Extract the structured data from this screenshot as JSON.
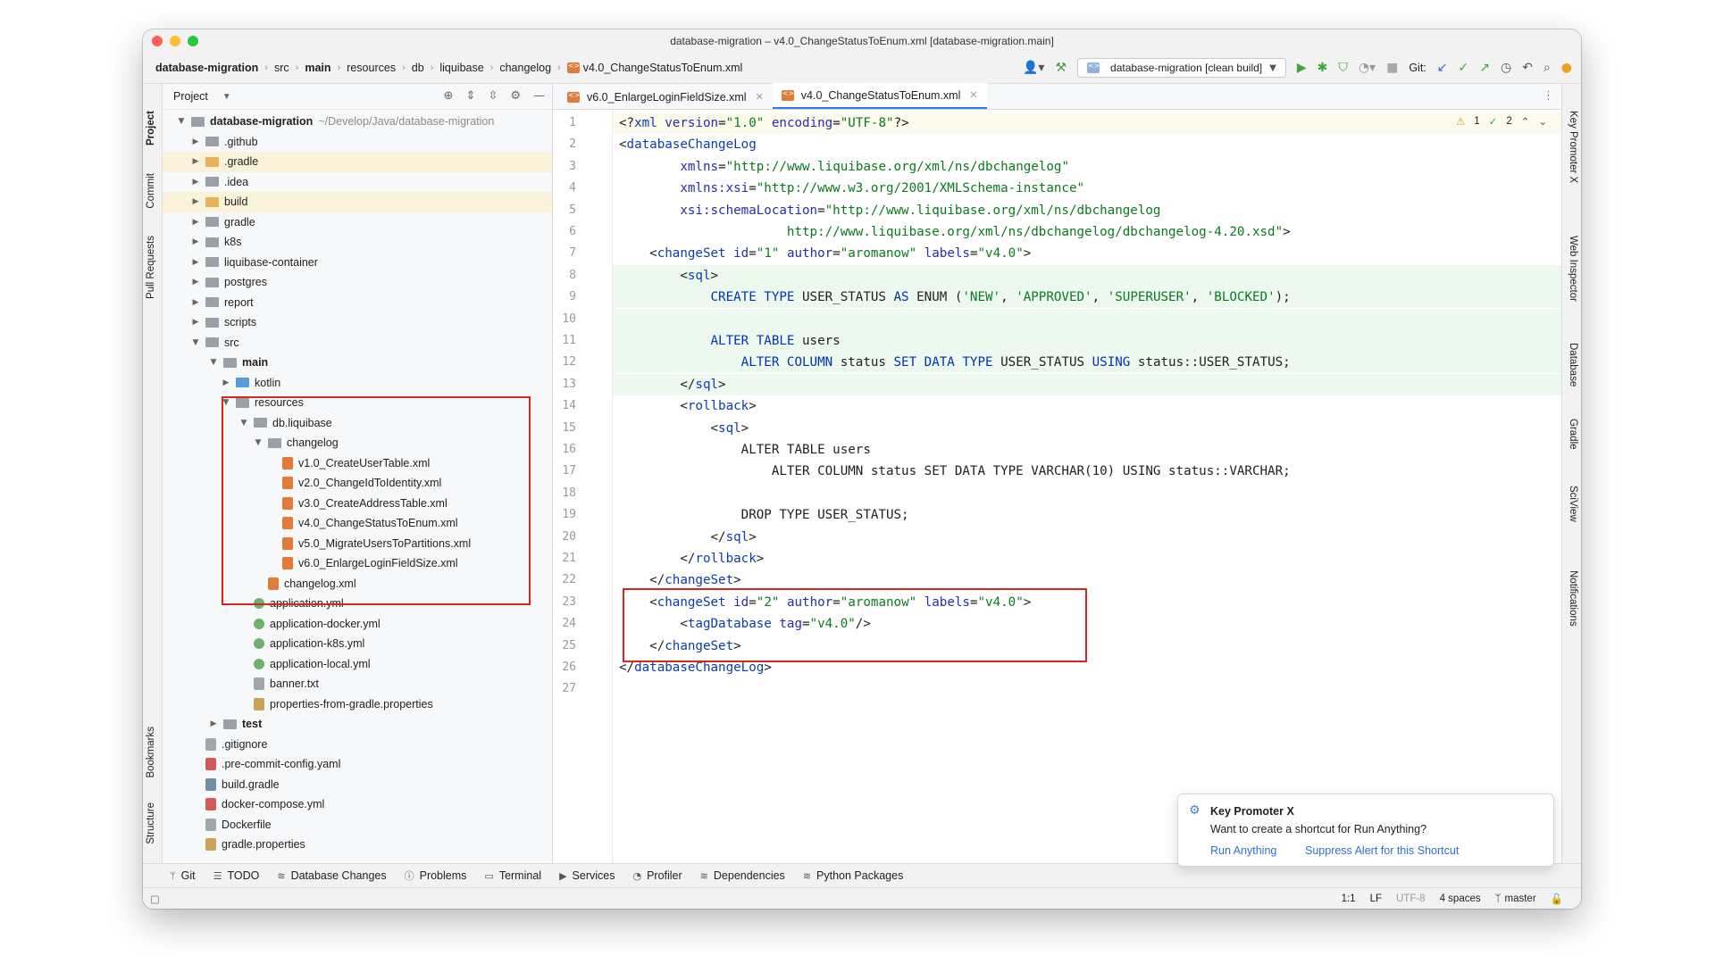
{
  "window": {
    "title": "database-migration – v4.0_ChangeStatusToEnum.xml [database-migration.main]"
  },
  "breadcrumbs": [
    "database-migration",
    "src",
    "main",
    "resources",
    "db",
    "liquibase",
    "changelog",
    "v4.0_ChangeStatusToEnum.xml"
  ],
  "toolbar": {
    "run_config": "database-migration [clean build]",
    "git_label": "Git:"
  },
  "left_stripe": [
    "Project",
    "Commit",
    "Pull Requests",
    "Bookmarks",
    "Structure"
  ],
  "right_stripe": [
    "Key Promoter X",
    "Web Inspector",
    "Database",
    "Gradle",
    "SciView",
    "Notifications"
  ],
  "project_panel": {
    "title": "Project",
    "tree": [
      {
        "label": "database-migration",
        "hint": "~/Develop/Java/database-migration",
        "type": "folder",
        "depth": 0,
        "expanded": true,
        "bold": true
      },
      {
        "label": ".github",
        "type": "folder",
        "depth": 1
      },
      {
        "label": ".gradle",
        "type": "folder-orange",
        "depth": 1,
        "hl": true
      },
      {
        "label": ".idea",
        "type": "folder",
        "depth": 1
      },
      {
        "label": "build",
        "type": "folder-orange",
        "depth": 1,
        "hl": true
      },
      {
        "label": "gradle",
        "type": "folder",
        "depth": 1
      },
      {
        "label": "k8s",
        "type": "folder",
        "depth": 1
      },
      {
        "label": "liquibase-container",
        "type": "folder",
        "depth": 1
      },
      {
        "label": "postgres",
        "type": "folder",
        "depth": 1
      },
      {
        "label": "report",
        "type": "folder",
        "depth": 1
      },
      {
        "label": "scripts",
        "type": "folder",
        "depth": 1
      },
      {
        "label": "src",
        "type": "folder",
        "depth": 1,
        "expanded": true
      },
      {
        "label": "main",
        "type": "folder",
        "depth": 2,
        "expanded": true,
        "bold": true
      },
      {
        "label": "kotlin",
        "type": "folder-blue",
        "depth": 3
      },
      {
        "label": "resources",
        "type": "folder",
        "depth": 3,
        "expanded": true
      },
      {
        "label": "db.liquibase",
        "type": "folder",
        "depth": 4,
        "expanded": true
      },
      {
        "label": "changelog",
        "type": "folder",
        "depth": 5,
        "expanded": true
      },
      {
        "label": "v1.0_CreateUserTable.xml",
        "type": "xml",
        "depth": 6,
        "leaf": true
      },
      {
        "label": "v2.0_ChangeIdToIdentity.xml",
        "type": "xml",
        "depth": 6,
        "leaf": true
      },
      {
        "label": "v3.0_CreateAddressTable.xml",
        "type": "xml",
        "depth": 6,
        "leaf": true
      },
      {
        "label": "v4.0_ChangeStatusToEnum.xml",
        "type": "xml",
        "depth": 6,
        "leaf": true
      },
      {
        "label": "v5.0_MigrateUsersToPartitions.xml",
        "type": "xml",
        "depth": 6,
        "leaf": true
      },
      {
        "label": "v6.0_EnlargeLoginFieldSize.xml",
        "type": "xml",
        "depth": 6,
        "leaf": true
      },
      {
        "label": "changelog.xml",
        "type": "xml",
        "depth": 5,
        "leaf": true
      },
      {
        "label": "application.yml",
        "type": "yml",
        "depth": 4,
        "leaf": true
      },
      {
        "label": "application-docker.yml",
        "type": "yml",
        "depth": 4,
        "leaf": true
      },
      {
        "label": "application-k8s.yml",
        "type": "yml",
        "depth": 4,
        "leaf": true
      },
      {
        "label": "application-local.yml",
        "type": "yml",
        "depth": 4,
        "leaf": true
      },
      {
        "label": "banner.txt",
        "type": "txt",
        "depth": 4,
        "leaf": true
      },
      {
        "label": "properties-from-gradle.properties",
        "type": "prop",
        "depth": 4,
        "leaf": true
      },
      {
        "label": "test",
        "type": "folder",
        "depth": 2,
        "bold": true
      },
      {
        "label": ".gitignore",
        "type": "txt",
        "depth": 1,
        "leaf": true
      },
      {
        "label": ".pre-commit-config.yaml",
        "type": "yaml",
        "depth": 1,
        "leaf": true
      },
      {
        "label": "build.gradle",
        "type": "gradle",
        "depth": 1,
        "leaf": true
      },
      {
        "label": "docker-compose.yml",
        "type": "yaml",
        "depth": 1,
        "leaf": true
      },
      {
        "label": "Dockerfile",
        "type": "txt",
        "depth": 1,
        "leaf": true
      },
      {
        "label": "gradle.properties",
        "type": "prop",
        "depth": 1,
        "leaf": true
      }
    ]
  },
  "editor_tabs": [
    {
      "label": "v6.0_EnlargeLoginFieldSize.xml",
      "active": false
    },
    {
      "label": "v4.0_ChangeStatusToEnum.xml",
      "active": true
    }
  ],
  "inspection": {
    "warnings": "1",
    "checks": "2"
  },
  "code_lines": [
    {
      "n": 1,
      "s": [
        [
          "pl",
          "<?"
        ],
        [
          "tg",
          "xml "
        ],
        [
          "at",
          "version"
        ],
        [
          "pl",
          "="
        ],
        [
          "vl",
          "\"1.0\""
        ],
        [
          "pl",
          " "
        ],
        [
          "at",
          "encoding"
        ],
        [
          "pl",
          "="
        ],
        [
          "vl",
          "\"UTF-8\""
        ],
        [
          "pl",
          "?>"
        ]
      ],
      "cur": true
    },
    {
      "n": 2,
      "s": [
        [
          "pl",
          "<"
        ],
        [
          "tg",
          "databaseChangeLog"
        ]
      ]
    },
    {
      "n": 3,
      "s": [
        [
          "pl",
          "        "
        ],
        [
          "at",
          "xmlns"
        ],
        [
          "pl",
          "="
        ],
        [
          "vl",
          "\"http://www.liquibase.org/xml/ns/dbchangelog\""
        ]
      ]
    },
    {
      "n": 4,
      "s": [
        [
          "pl",
          "        "
        ],
        [
          "at",
          "xmlns:xsi"
        ],
        [
          "pl",
          "="
        ],
        [
          "vl",
          "\"http://www.w3.org/2001/XMLSchema-instance\""
        ]
      ]
    },
    {
      "n": 5,
      "s": [
        [
          "pl",
          "        "
        ],
        [
          "at",
          "xsi:schemaLocation"
        ],
        [
          "pl",
          "="
        ],
        [
          "vl",
          "\"http://www.liquibase.org/xml/ns/dbchangelog"
        ]
      ]
    },
    {
      "n": 6,
      "s": [
        [
          "vl",
          "                      http://www.liquibase.org/xml/ns/dbchangelog/dbchangelog-4.20.xsd\""
        ],
        [
          "pl",
          ">"
        ]
      ]
    },
    {
      "n": 7,
      "s": [
        [
          "pl",
          "    <"
        ],
        [
          "tg",
          "changeSet "
        ],
        [
          "at",
          "id"
        ],
        [
          "pl",
          "="
        ],
        [
          "vl",
          "\"1\" "
        ],
        [
          "at",
          "author"
        ],
        [
          "pl",
          "="
        ],
        [
          "vl",
          "\"aromanow\" "
        ],
        [
          "at",
          "labels"
        ],
        [
          "pl",
          "="
        ],
        [
          "vl",
          "\"v4.0\""
        ],
        [
          "pl",
          ">"
        ]
      ]
    },
    {
      "n": 8,
      "s": [
        [
          "pl",
          "        <"
        ],
        [
          "tg",
          "sql"
        ],
        [
          "pl",
          ">"
        ]
      ],
      "added": true
    },
    {
      "n": 9,
      "s": [
        [
          "pl",
          "            "
        ],
        [
          "kw",
          "CREATE TYPE "
        ],
        [
          "pl",
          "USER_STATUS "
        ],
        [
          "kw",
          "AS "
        ],
        [
          "pl",
          "ENUM ("
        ],
        [
          "vl",
          "'NEW'"
        ],
        [
          "pl",
          ", "
        ],
        [
          "vl",
          "'APPROVED'"
        ],
        [
          "pl",
          ", "
        ],
        [
          "vl",
          "'SUPERUSER'"
        ],
        [
          "pl",
          ", "
        ],
        [
          "vl",
          "'BLOCKED'"
        ],
        [
          "pl",
          ");"
        ]
      ],
      "added": true
    },
    {
      "n": 10,
      "s": [
        [
          "pl",
          ""
        ]
      ],
      "added": true
    },
    {
      "n": 11,
      "s": [
        [
          "pl",
          "            "
        ],
        [
          "kw",
          "ALTER TABLE "
        ],
        [
          "pl",
          "users"
        ]
      ],
      "added": true
    },
    {
      "n": 12,
      "s": [
        [
          "pl",
          "                "
        ],
        [
          "kw",
          "ALTER COLUMN "
        ],
        [
          "pl",
          "status "
        ],
        [
          "kw",
          "SET DATA TYPE "
        ],
        [
          "pl",
          "USER_STATUS "
        ],
        [
          "kw",
          "USING "
        ],
        [
          "pl",
          "status::USER_STATUS;"
        ]
      ],
      "added": true
    },
    {
      "n": 13,
      "s": [
        [
          "pl",
          "        </"
        ],
        [
          "tg",
          "sql"
        ],
        [
          "pl",
          ">"
        ]
      ],
      "added": true
    },
    {
      "n": 14,
      "s": [
        [
          "pl",
          "        <"
        ],
        [
          "tg",
          "rollback"
        ],
        [
          "pl",
          ">"
        ]
      ]
    },
    {
      "n": 15,
      "s": [
        [
          "pl",
          "            <"
        ],
        [
          "tg",
          "sql"
        ],
        [
          "pl",
          ">"
        ]
      ]
    },
    {
      "n": 16,
      "s": [
        [
          "pl",
          "                ALTER TABLE users"
        ]
      ]
    },
    {
      "n": 17,
      "s": [
        [
          "pl",
          "                    ALTER COLUMN status SET DATA TYPE VARCHAR(10) USING status::VARCHAR;"
        ]
      ]
    },
    {
      "n": 18,
      "s": [
        [
          "pl",
          ""
        ]
      ]
    },
    {
      "n": 19,
      "s": [
        [
          "pl",
          "                DROP TYPE USER_STATUS;"
        ]
      ]
    },
    {
      "n": 20,
      "s": [
        [
          "pl",
          "            </"
        ],
        [
          "tg",
          "sql"
        ],
        [
          "pl",
          ">"
        ]
      ]
    },
    {
      "n": 21,
      "s": [
        [
          "pl",
          "        </"
        ],
        [
          "tg",
          "rollback"
        ],
        [
          "pl",
          ">"
        ]
      ]
    },
    {
      "n": 22,
      "s": [
        [
          "pl",
          "    </"
        ],
        [
          "tg",
          "changeSet"
        ],
        [
          "pl",
          ">"
        ]
      ]
    },
    {
      "n": 23,
      "s": [
        [
          "pl",
          "    <"
        ],
        [
          "tg",
          "changeSet "
        ],
        [
          "at",
          "id"
        ],
        [
          "pl",
          "="
        ],
        [
          "vl",
          "\"2\" "
        ],
        [
          "at",
          "author"
        ],
        [
          "pl",
          "="
        ],
        [
          "vl",
          "\"aromanow\" "
        ],
        [
          "at",
          "labels"
        ],
        [
          "pl",
          "="
        ],
        [
          "vl",
          "\"v4.0\""
        ],
        [
          "pl",
          ">"
        ]
      ]
    },
    {
      "n": 24,
      "s": [
        [
          "pl",
          "        <"
        ],
        [
          "tg",
          "tagDatabase "
        ],
        [
          "at",
          "tag"
        ],
        [
          "pl",
          "="
        ],
        [
          "vl",
          "\"v4.0\""
        ],
        [
          "pl",
          "/>"
        ]
      ]
    },
    {
      "n": 25,
      "s": [
        [
          "pl",
          "    </"
        ],
        [
          "tg",
          "changeSet"
        ],
        [
          "pl",
          ">"
        ]
      ]
    },
    {
      "n": 26,
      "s": [
        [
          "pl",
          "</"
        ],
        [
          "tg",
          "databaseChangeLog"
        ],
        [
          "pl",
          ">"
        ]
      ]
    },
    {
      "n": 27,
      "s": [
        [
          "pl",
          ""
        ]
      ]
    }
  ],
  "popup": {
    "title": "Key Promoter X",
    "message": "Want to create a shortcut for Run Anything?",
    "action_primary": "Run Anything",
    "action_secondary": "Suppress Alert for this Shortcut"
  },
  "bottom_tabs": [
    "Git",
    "TODO",
    "Database Changes",
    "Problems",
    "Terminal",
    "Services",
    "Profiler",
    "Dependencies",
    "Python Packages"
  ],
  "status": {
    "position": "1:1",
    "line_sep": "LF",
    "encoding": "UTF-8",
    "indent": "4 spaces",
    "branch": "master"
  }
}
